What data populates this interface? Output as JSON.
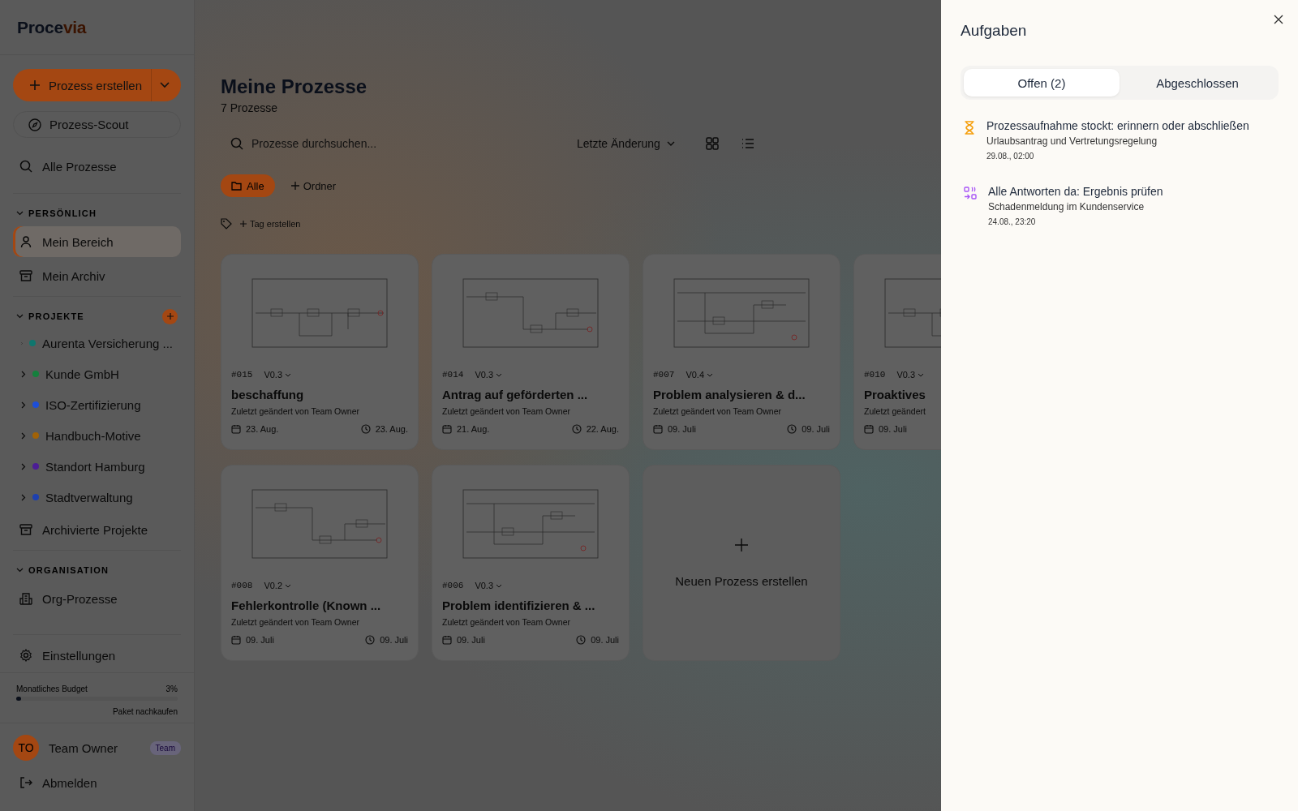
{
  "logo": {
    "part_1": "Proce",
    "part_2": "via"
  },
  "sidebar": {
    "create_button": "Prozess erstellen",
    "scout_button": "Prozess-Scout",
    "all_processes": "Alle Prozesse",
    "sections": [
      {
        "title": "PERSÖNLICH",
        "items": [
          {
            "label": "Mein Bereich",
            "selected": true
          },
          {
            "label": "Mein Archiv",
            "selected": false
          }
        ]
      },
      {
        "title": "PROJEKTE",
        "has_add": true,
        "projects": [
          {
            "label": "Aurenta Versicherung ...",
            "color": "#0f766e"
          },
          {
            "label": "Kunde GmbH",
            "color": "#15803d"
          },
          {
            "label": "ISO-Zertifizierung",
            "color": "#1d4ed8"
          },
          {
            "label": "Handbuch-Motive",
            "color": "#a16207"
          },
          {
            "label": "Standort Hamburg",
            "color": "#4c1d95"
          },
          {
            "label": "Stadtverwaltung",
            "color": "#1e40af"
          }
        ],
        "items": [
          {
            "label": "Archivierte Projekte",
            "selected": false
          }
        ]
      },
      {
        "title": "ORGANISATION",
        "items": [
          {
            "label": "Org-Prozesse",
            "selected": false
          }
        ]
      }
    ],
    "settings": "Einstellungen",
    "budget": {
      "label": "Monatliches Budget",
      "reading": "3%",
      "level": 0.03,
      "link": "Paket nachkaufen"
    },
    "user": {
      "initials": "TO",
      "name": "Team Owner",
      "badge": "Team"
    },
    "logout": "Abmelden"
  },
  "main": {
    "title": "Meine Prozesse",
    "count": "7 Prozesse",
    "search": {
      "placeholder": "Prozesse durchsuchen..."
    },
    "sort": "Letzte Änderung",
    "folders": [
      {
        "label": "Alle",
        "selected": true
      }
    ],
    "add_folder": "Ordner",
    "add_tag": "Tag erstellen",
    "cards": [
      {
        "id": "#015",
        "version": "V0.3",
        "title": "beschaffung",
        "subtitle": "Zuletzt geändert von Team Owner",
        "created": "23. Aug.",
        "modified": "23. Aug."
      },
      {
        "id": "#014",
        "version": "V0.3",
        "title": "Antrag auf geförderten ...",
        "subtitle": "Zuletzt geändert von Team Owner",
        "created": "21. Aug.",
        "modified": "22. Aug."
      },
      {
        "id": "#007",
        "version": "V0.4",
        "title": "Problem analysieren & d...",
        "subtitle": "Zuletzt geändert von Team Owner",
        "created": "09. Juli",
        "modified": "09. Juli"
      },
      {
        "id": "#010",
        "version": "V0.3",
        "title": "Proaktives",
        "subtitle": "Zuletzt geändert",
        "created": "09. Juli"
      },
      {
        "id": "#008",
        "version": "V0.2",
        "title": "Fehlerkontrolle (Known ...",
        "subtitle": "Zuletzt geändert von Team Owner",
        "created": "09. Juli",
        "modified": "09. Juli"
      },
      {
        "id": "#006",
        "version": "V0.3",
        "title": "Problem identifizieren & ...",
        "subtitle": "Zuletzt geändert von Team Owner",
        "created": "09. Juli",
        "modified": "09. Juli"
      }
    ],
    "new_card": "Neuen Prozess erstellen"
  },
  "drawer": {
    "title": "Aufgaben",
    "tabs": [
      {
        "label": "Offen (2)",
        "selected": true
      },
      {
        "label": "Abgeschlossen",
        "selected": false
      }
    ],
    "tasks": [
      {
        "kind": "waiting",
        "title": "Prozessaufnahme stockt: erinnern oder abschließen",
        "process": "Urlaubsantrag und Vertretungsregelung",
        "time": "29.08., 02:00"
      },
      {
        "kind": "review",
        "title": "Alle Antworten da: Ergebnis prüfen",
        "process": "Schadenmeldung im Kundenservice",
        "time": "24.08., 23:20"
      }
    ]
  }
}
